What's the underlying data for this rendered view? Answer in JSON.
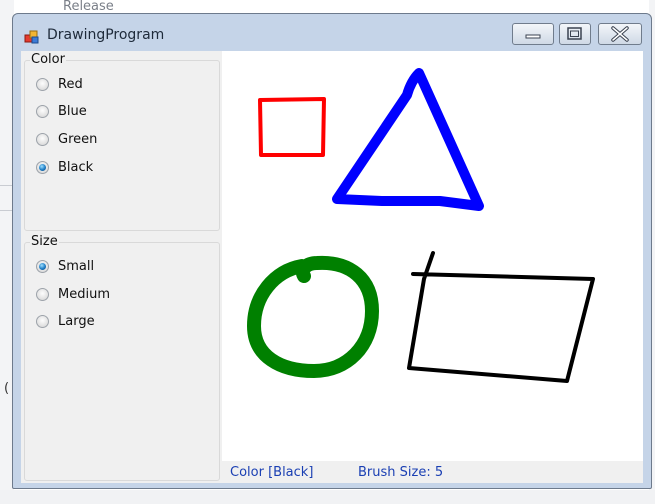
{
  "background": {
    "release_text": "Release",
    "paren_text": "("
  },
  "window": {
    "title": "DrawingProgram",
    "minimize_icon": "minimize-icon",
    "maximize_icon": "maximize-icon",
    "close_icon": "close-icon"
  },
  "color_group": {
    "title": "Color",
    "options": [
      {
        "label": "Red",
        "checked": false
      },
      {
        "label": "Blue",
        "checked": false
      },
      {
        "label": "Green",
        "checked": false
      },
      {
        "label": "Black",
        "checked": true
      }
    ]
  },
  "size_group": {
    "title": "Size",
    "options": [
      {
        "label": "Small",
        "checked": true
      },
      {
        "label": "Medium",
        "checked": false
      },
      {
        "label": "Large",
        "checked": false
      }
    ]
  },
  "status": {
    "color_text": "Color [Black]",
    "brush_text": "Brush Size: 5"
  },
  "drawing": {
    "strokes": [
      {
        "shape": "square",
        "color": "#ff0000"
      },
      {
        "shape": "triangle",
        "color": "#0000ff"
      },
      {
        "shape": "circle",
        "color": "#008000"
      },
      {
        "shape": "parallelogram",
        "color": "#000000"
      }
    ]
  }
}
